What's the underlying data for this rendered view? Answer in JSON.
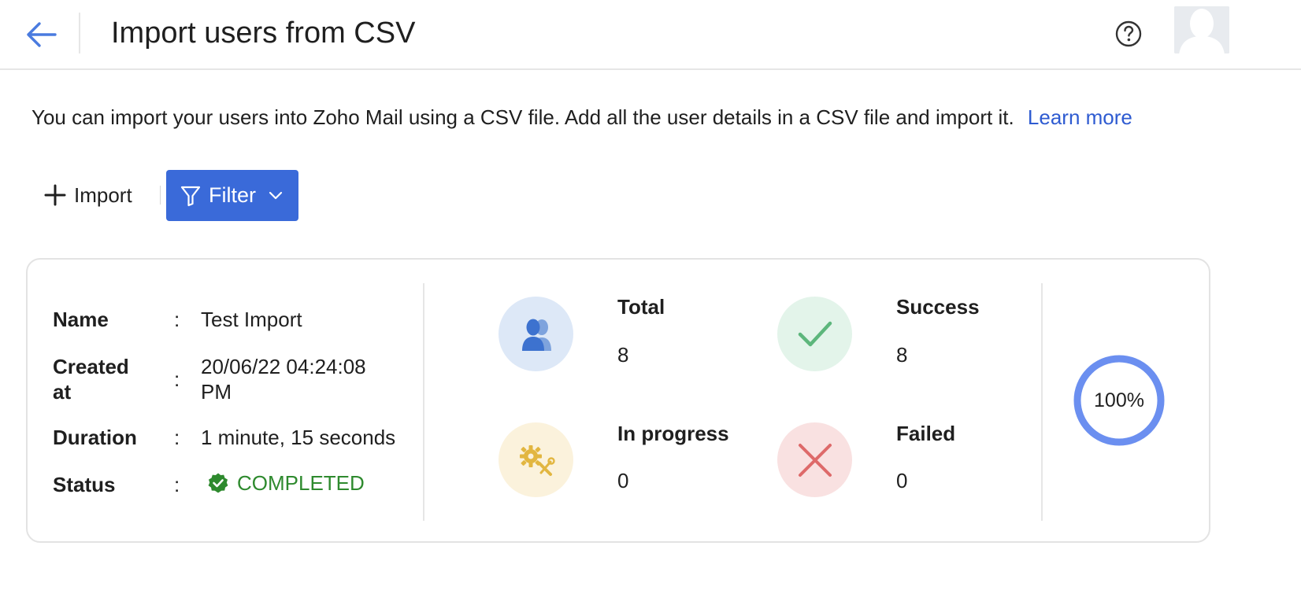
{
  "header": {
    "title": "Import users from CSV",
    "back_icon": "arrow-left-icon",
    "help_icon": "question-circle-icon",
    "avatar_icon": "user-silhouette-icon"
  },
  "intro": {
    "text": "You can import your users into Zoho Mail using a CSV file. Add all the user details in a CSV file and import it.",
    "link_label": "Learn more"
  },
  "toolbar": {
    "import_label": "Import",
    "filter_label": "Filter"
  },
  "import_record": {
    "details": [
      {
        "label": "Name",
        "value": "Test Import"
      },
      {
        "label": "Created at",
        "value": "20/06/22 04:24:08 PM"
      },
      {
        "label": "Duration",
        "value": "1 minute, 15 seconds"
      },
      {
        "label": "Status",
        "value": "COMPLETED"
      }
    ],
    "colon": ":",
    "stats": [
      {
        "label": "Total",
        "value": "8",
        "icon": "users-icon"
      },
      {
        "label": "Success",
        "value": "8",
        "icon": "check-icon"
      },
      {
        "label": "In progress",
        "value": "0",
        "icon": "gears-tools-icon"
      },
      {
        "label": "Failed",
        "value": "0",
        "icon": "cross-icon"
      }
    ],
    "progress": {
      "percent": 100,
      "label": "100%"
    }
  },
  "colors": {
    "accent": "#3a6ad9",
    "link": "#2e5bd1",
    "success_text": "#2e8a2e",
    "progress_ring": "#6b8ff0",
    "total_bg": "#dde8f7",
    "success_bg": "#e3f4ea",
    "progress_bg": "#fbf2dc",
    "failed_bg": "#f9e1e1"
  }
}
